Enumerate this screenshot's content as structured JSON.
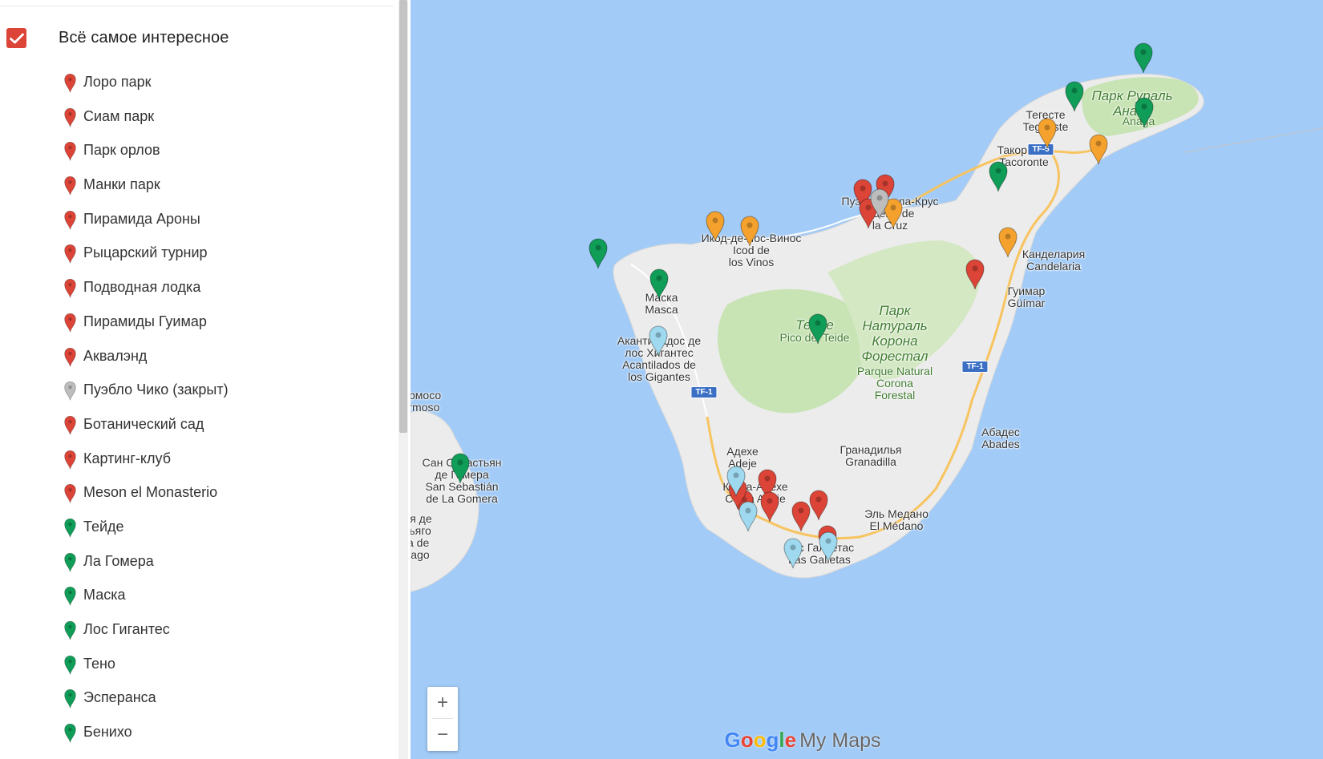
{
  "sidebar": {
    "layer_title": "Всё самое интересное",
    "layer_checked": true,
    "items": [
      {
        "label": "Лоро парк",
        "color": "#db4437"
      },
      {
        "label": "Сиам парк",
        "color": "#db4437"
      },
      {
        "label": "Парк орлов",
        "color": "#db4437"
      },
      {
        "label": "Манки парк",
        "color": "#db4437"
      },
      {
        "label": "Пирамида Ароны",
        "color": "#db4437"
      },
      {
        "label": "Рыцарский турнир",
        "color": "#db4437"
      },
      {
        "label": "Подводная лодка",
        "color": "#db4437"
      },
      {
        "label": "Пирамиды Гуимар",
        "color": "#db4437"
      },
      {
        "label": "Аквалэнд",
        "color": "#db4437"
      },
      {
        "label": "Пуэбло Чико (закрыт)",
        "color": "#bdbdbd"
      },
      {
        "label": "Ботанический сад",
        "color": "#db4437"
      },
      {
        "label": "Картинг-клуб",
        "color": "#db4437"
      },
      {
        "label": "Meson el Monasterio",
        "color": "#db4437"
      },
      {
        "label": "Тейде",
        "color": "#0f9d58"
      },
      {
        "label": "Ла Гомера",
        "color": "#0f9d58"
      },
      {
        "label": "Маска",
        "color": "#0f9d58"
      },
      {
        "label": "Лос Гигантес",
        "color": "#0f9d58"
      },
      {
        "label": "Тено",
        "color": "#0f9d58"
      },
      {
        "label": "Эсперанса",
        "color": "#0f9d58"
      },
      {
        "label": "Бенихо",
        "color": "#0f9d58"
      }
    ]
  },
  "map": {
    "labels": [
      {
        "text": "Парк Рураль\nАнага",
        "kind": "park"
      },
      {
        "text": "Anaga",
        "kind": "park-sub"
      },
      {
        "text": "Тегесте\nTegueste",
        "kind": "town"
      },
      {
        "text": "Такоронте\nTacoronte",
        "kind": "town"
      },
      {
        "text": "Пуэрто-де-ла-Крус\nPuerto de\nla Cruz",
        "kind": "town"
      },
      {
        "text": "Икод-де-лос-Винос\nIcod de\nlos Vinos",
        "kind": "town"
      },
      {
        "text": "Маска\nMasca",
        "kind": "town"
      },
      {
        "text": "Акантиладос де\nлос Хигантес\nAcantilados de\nlos Gigantes",
        "kind": "town"
      },
      {
        "text": "Тейде",
        "kind": "park"
      },
      {
        "text": "Pico del Teide",
        "kind": "park-sub"
      },
      {
        "text": "Парк\nНатураль\nКорона\nФорестал",
        "kind": "park"
      },
      {
        "text": "Parque Natural\nCorona\nForestal",
        "kind": "park-sub"
      },
      {
        "text": "Канделария\nCandelaria",
        "kind": "town"
      },
      {
        "text": "Гуимар\nGüímar",
        "kind": "town"
      },
      {
        "text": "Абадес\nAbades",
        "kind": "town"
      },
      {
        "text": "Гранадилья\nGranadilla",
        "kind": "town"
      },
      {
        "text": "Адехе\nAdeje",
        "kind": "town"
      },
      {
        "text": "Коста-Адехе\nCosta Adeje",
        "kind": "town"
      },
      {
        "text": "Эль Медано\nEl Médano",
        "kind": "town"
      },
      {
        "text": "Лас Гальетас\nLas Galletas",
        "kind": "town"
      },
      {
        "text": "Сан Себастьян\nде Гомера\nSan Sebastián\nde La Gomera",
        "kind": "town"
      },
      {
        "text": "Вальеермосо\nVallehermoso",
        "kind": "town"
      },
      {
        "text": "Плайя де\nСантьяго\nPlaya de\nSantiago",
        "kind": "town"
      }
    ],
    "roads": [
      "TF-5",
      "TF-1",
      "TF-1"
    ],
    "zoom_in": "+",
    "zoom_out": "−",
    "brand": {
      "google": "Google",
      "mymaps": "My Maps"
    },
    "marker_colors": {
      "red": "#db4437",
      "green": "#0f9d58",
      "orange": "#f4a22d",
      "blue": "#9fd9ef",
      "grey": "#bdbdbd"
    }
  }
}
